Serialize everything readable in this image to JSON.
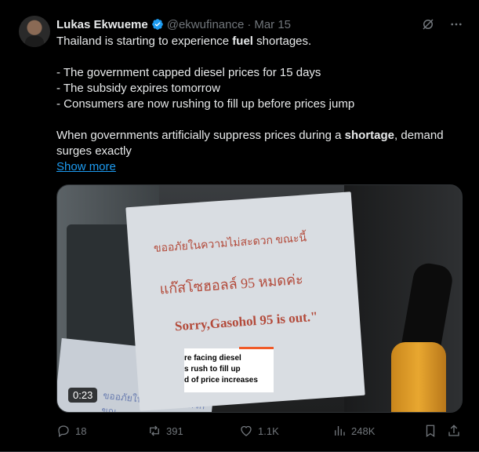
{
  "post": {
    "author_name": "Lukas Ekwueme",
    "handle": "@ekwufinance",
    "separator": "·",
    "date": "Mar 15",
    "text_line1_pre": "Thailand is starting to experience ",
    "text_line1_bold": "fuel",
    "text_line1_post": " shortages.",
    "bullets": [
      "- The government capped diesel prices for 15 days",
      "- The subsidy expires tomorrow",
      "-  Consumers are now rushing to fill up before prices jump"
    ],
    "text_last_pre": "When governments artificially suppress prices during a ",
    "text_last_bold": "shortage",
    "text_last_post": ", demand surges exactly",
    "show_more": "Show more"
  },
  "media": {
    "sign_line1": "ขออภัยในความไม่สะดวก ขณะนี้",
    "sign_line2": "แก๊สโซฮอลล์ 95 หมดค่ะ",
    "sign_line3": "Sorry,Gasohol 95 is out.\"",
    "paper2_text": "ขออภัยในความไม่สะดวก ขณ",
    "caption_lines": [
      "re facing diesel",
      "s rush to fill up",
      "d of price increases"
    ],
    "duration": "0:23"
  },
  "actions": {
    "replies": "18",
    "reposts": "391",
    "likes": "1.1K",
    "views": "248K"
  },
  "colors": {
    "accent": "#1d9bf0",
    "muted": "#71767b",
    "text": "#e7e9ea"
  }
}
